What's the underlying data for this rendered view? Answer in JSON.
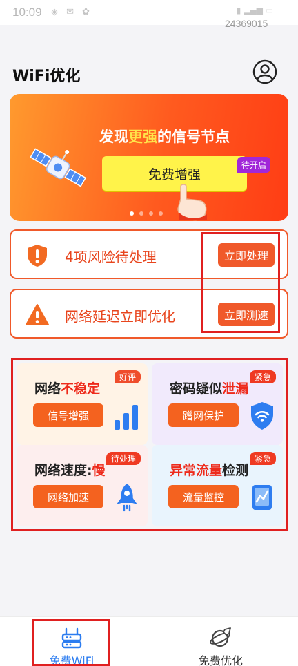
{
  "status_bar": {
    "time": "10:09",
    "watermark": "24369015"
  },
  "header": {
    "title": "WiFi优化",
    "profile_icon": "user-circle-icon"
  },
  "banner": {
    "headline_pre": "发现",
    "headline_highlight": "更强",
    "headline_post": "的信号节点",
    "cta_label": "免费增强",
    "badge": "待开启",
    "page_count": 4,
    "active_page": 1,
    "colors": {
      "start": "#ff9a2e",
      "end": "#ff3d14",
      "highlight": "#ffe44a"
    }
  },
  "alerts": [
    {
      "icon": "shield-exclamation-icon",
      "text": "4项风险待处理",
      "button": "立即处理"
    },
    {
      "icon": "warning-triangle-icon",
      "text": "网络延迟立即优化",
      "button": "立即测速"
    }
  ],
  "cards": [
    {
      "title_pre": "网络",
      "title_red": "不稳定",
      "title_post": "",
      "tag": "好评",
      "button": "信号增强",
      "icon": "signal-bars-icon"
    },
    {
      "title_pre": "密码疑似",
      "title_red": "泄漏",
      "title_post": "",
      "tag": "紧急",
      "button": "蹭网保护",
      "icon": "wifi-shield-icon"
    },
    {
      "title_pre": "网络速度:",
      "title_red": "慢",
      "title_post": "",
      "tag": "待处理",
      "button": "网络加速",
      "icon": "rocket-icon"
    },
    {
      "title_pre": "",
      "title_red": "异常流量",
      "title_post": "检测",
      "tag": "紧急",
      "button": "流量监控",
      "icon": "traffic-monitor-icon"
    }
  ],
  "tabbar": {
    "tabs": [
      {
        "label": "免费WiFi",
        "icon": "router-icon",
        "active": true
      },
      {
        "label": "免费优化",
        "icon": "planet-rocket-icon",
        "active": false
      }
    ]
  },
  "colors": {
    "accent": "#f4621f",
    "alert_border": "#f0592a",
    "highlight_red": "#ee2a1b",
    "tab_active": "#2b7cf0"
  }
}
